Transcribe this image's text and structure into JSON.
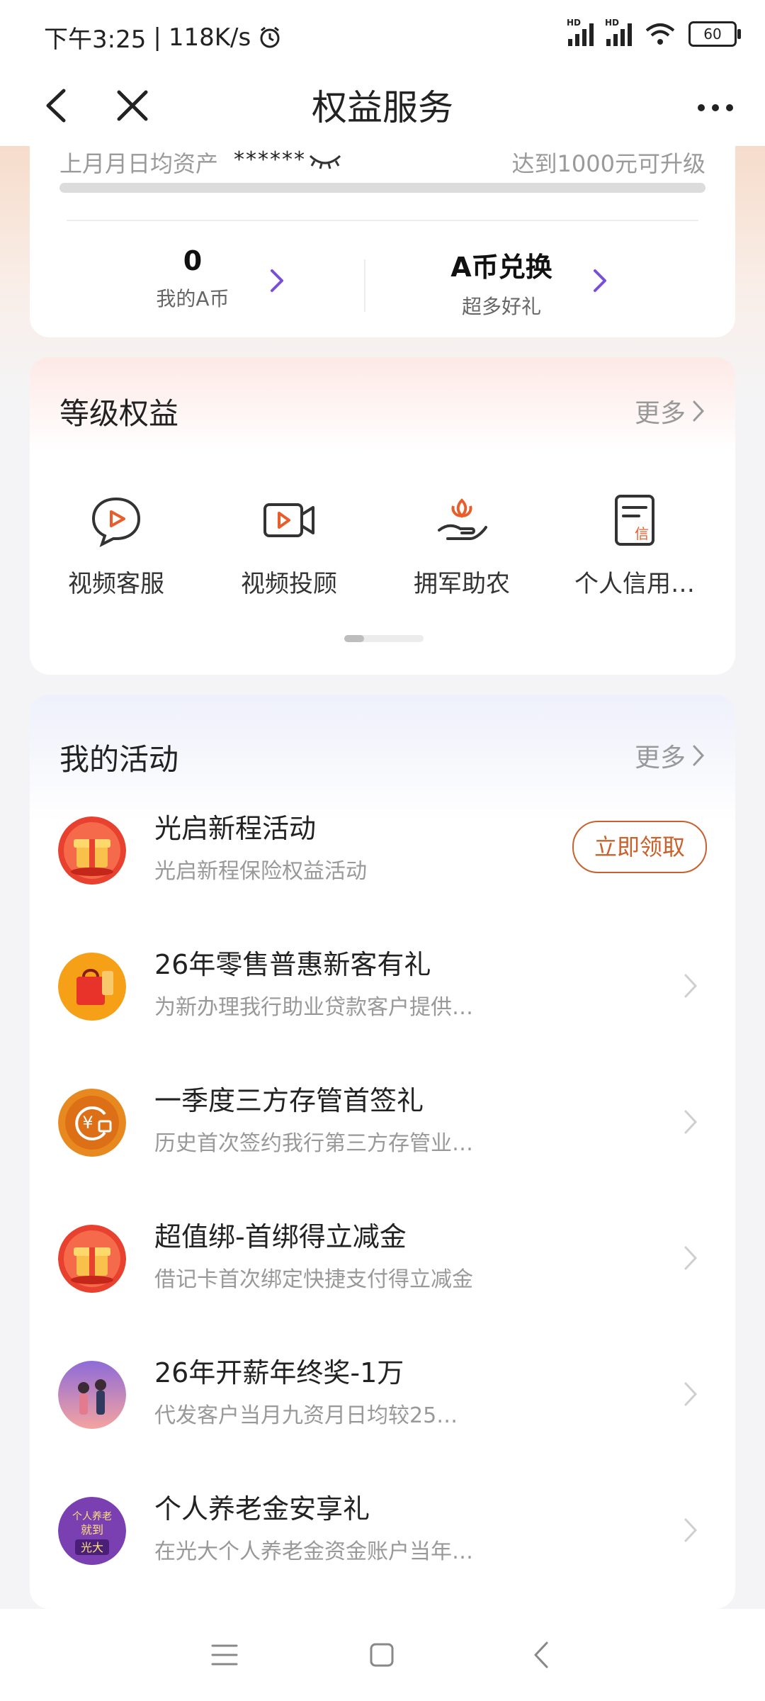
{
  "status_bar": {
    "time": "下午3:25",
    "separator": "|",
    "speed": "118K/s",
    "signal1_label": "HD",
    "signal2_label": "HD",
    "battery": "60"
  },
  "nav": {
    "title": "权益服务"
  },
  "assets": {
    "label": "上月月日均资产",
    "masked_value": "******",
    "upgrade_hint": "达到1000元可升级",
    "progress": 0,
    "coins_value": "0",
    "coins_label": "我的A币",
    "exchange_title": "A币兑换",
    "exchange_sub": "超多好礼"
  },
  "tiers": {
    "title": "等级权益",
    "more": "更多",
    "items": [
      {
        "label": "视频客服",
        "icon": "video-chat-icon"
      },
      {
        "label": "视频投顾",
        "icon": "video-camera-icon"
      },
      {
        "label": "拥军助农",
        "icon": "hand-flower-icon"
      },
      {
        "label": "个人信用…",
        "icon": "credit-doc-icon"
      }
    ],
    "page_index": 1,
    "page_count": 4
  },
  "activities": {
    "title": "我的活动",
    "more": "更多",
    "claim_label": "立即领取",
    "items": [
      {
        "title": "光启新程活动",
        "subtitle": "光启新程保险权益活动",
        "icon": "gift-box-icon",
        "color": "#e8412f"
      },
      {
        "title": "26年零售普惠新客有礼",
        "subtitle": "为新办理我行助业贷款客户提供…",
        "icon": "gift-bag-icon",
        "color": "#f5a017"
      },
      {
        "title": "一季度三方存管首签礼",
        "subtitle": "历史首次签约我行第三方存管业…",
        "icon": "yuan-gift-icon",
        "color": "#e8891f"
      },
      {
        "title": "超值绑-首绑得立减金",
        "subtitle": "借记卡首次绑定快捷支付得立减金",
        "icon": "gift-box-icon",
        "color": "#e8412f"
      },
      {
        "title": "26年开薪年终奖-1万",
        "subtitle": "代发客户当月九资月日均较25…",
        "icon": "couple-icon",
        "color": "#8d6bd8"
      },
      {
        "title": "个人养老金安享礼",
        "subtitle": "在光大个人养老金资金账户当年…",
        "icon": "pension-icon",
        "color": "#7a3fb0",
        "badge_top": "个人养老",
        "badge_mid": "就到",
        "badge_bottom": "光大"
      }
    ]
  },
  "colors": {
    "accent_orange": "#c8612c",
    "accent_purple": "#7a4fd6"
  }
}
